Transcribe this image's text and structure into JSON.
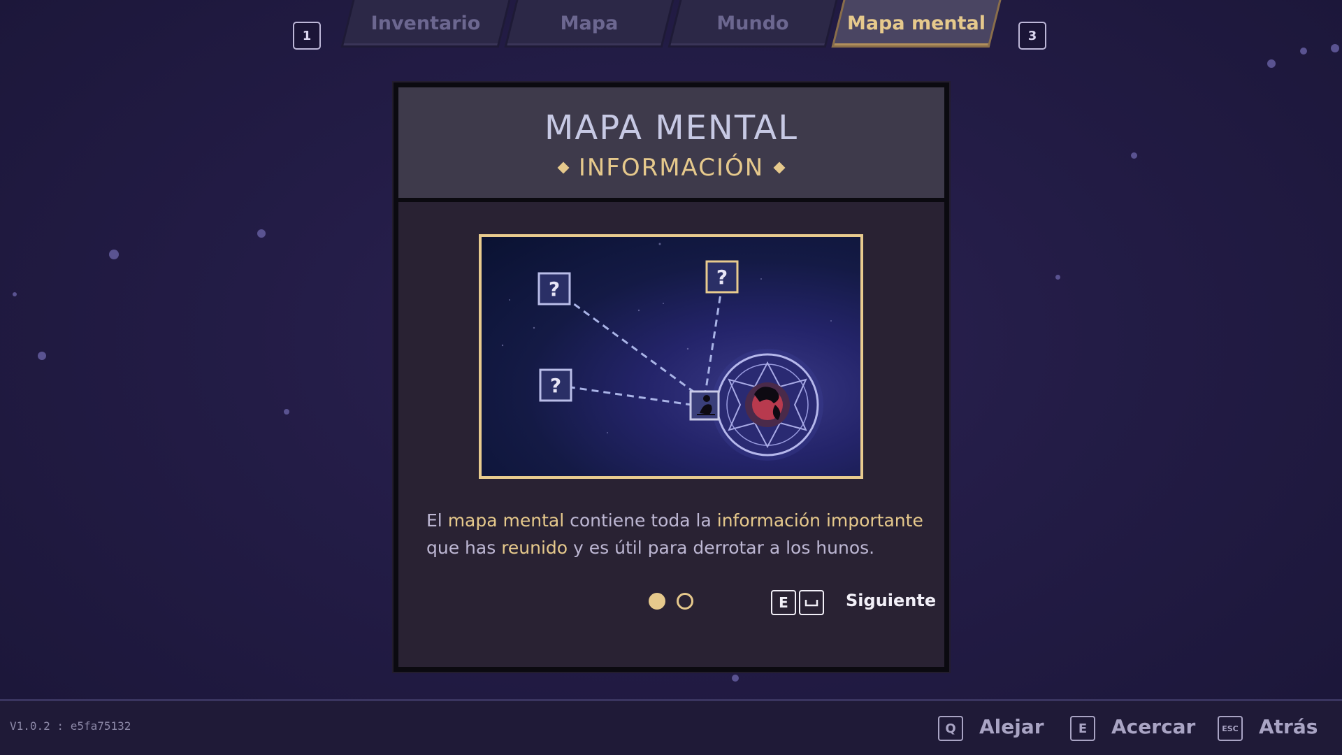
{
  "tabs": {
    "prev_key": "1",
    "next_key": "3",
    "items": [
      {
        "label": "Inventario",
        "active": false
      },
      {
        "label": "Mapa",
        "active": false
      },
      {
        "label": "Mundo",
        "active": false
      },
      {
        "label": "Mapa mental",
        "active": true
      }
    ]
  },
  "panel": {
    "title": "MAPA MENTAL",
    "subtitle": "INFORMACIÓN",
    "illustration": {
      "unknown_node_glyph": "?",
      "nodes": [
        "unknown-node",
        "unknown-node",
        "unknown-node",
        "character-node",
        "mandala-portrait-node"
      ]
    },
    "description": {
      "line1": [
        {
          "text": "El ",
          "highlight": false
        },
        {
          "text": "mapa mental",
          "highlight": true
        },
        {
          "text": " contiene toda la ",
          "highlight": false
        },
        {
          "text": "información importante",
          "highlight": true
        }
      ],
      "line2": [
        {
          "text": "que has ",
          "highlight": false
        },
        {
          "text": "reunido",
          "highlight": true
        },
        {
          "text": " y es útil para derrotar a los hunos.",
          "highlight": false
        }
      ]
    },
    "pagination": {
      "current": 1,
      "total": 2
    },
    "next": {
      "key1": "E",
      "key2_icon": "space-bar-icon",
      "label": "Siguiente"
    }
  },
  "bottom_bar": {
    "version": "V1.0.2 : e5fa75132",
    "actions": [
      {
        "key": "Q",
        "label": "Alejar"
      },
      {
        "key": "E",
        "label": "Acercar"
      },
      {
        "key": "ESC",
        "label": "Atrás"
      }
    ]
  },
  "colors": {
    "accent_gold": "#e6c98c",
    "background": "#231c46",
    "panel": "#292233",
    "panel_header": "#3e3a4b"
  }
}
